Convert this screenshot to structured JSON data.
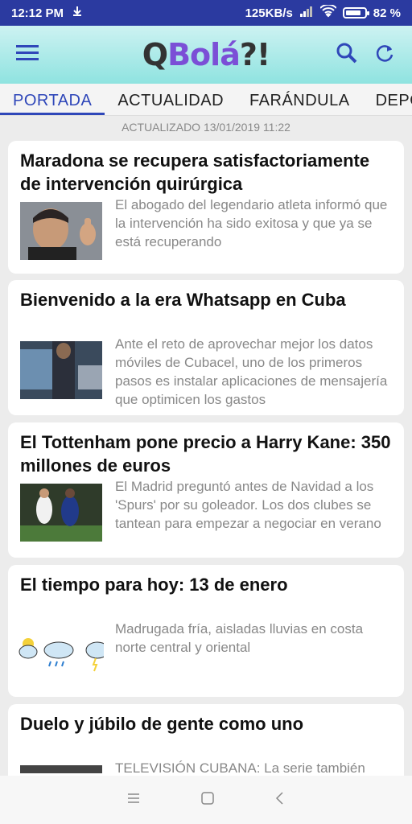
{
  "status": {
    "time": "12:12 PM",
    "speed": "125KB/s",
    "battery": "82 %",
    "battery_level": 0.82
  },
  "app": {
    "logo_q": "Q",
    "logo_bola": "Bolá",
    "logo_punct": "?!"
  },
  "tabs": [
    {
      "label": "PORTADA"
    },
    {
      "label": "ACTUALIDAD"
    },
    {
      "label": "FARÁNDULA"
    },
    {
      "label": "DEPORTES"
    }
  ],
  "updated": "ACTUALIZADO 13/01/2019 11:22",
  "articles": [
    {
      "title": "Maradona se recupera satisfactoriamente de intervención quirúrgica",
      "summary": "El abogado del legendario atleta informó que la intervención ha sido exitosa y que ya se está recuperando"
    },
    {
      "title": "Bienvenido a la era Whatsapp en Cuba",
      "summary": "Ante el reto de aprovechar mejor los datos móviles de Cubacel, uno de los primeros pasos es instalar aplicaciones de mensajería que optimicen los gastos"
    },
    {
      "title": "El Tottenham pone precio a Harry Kane: 350 millones de euros",
      "summary": "El Madrid preguntó antes de Navidad a los 'Spurs' por su goleador. Los dos clubes se tantean para empezar a negociar en verano"
    },
    {
      "title": "El tiempo para hoy: 13 de enero",
      "summary": "Madrugada fría, aisladas lluvias en costa norte central y oriental"
    },
    {
      "title": "Duelo y júbilo de gente como uno",
      "summary": "TELEVISIÓN CUBANA: La serie también"
    }
  ],
  "colors": {
    "statusbar": "#2b3aa0",
    "accent": "#2f47b9",
    "logo_purple": "#7b4fd6"
  }
}
